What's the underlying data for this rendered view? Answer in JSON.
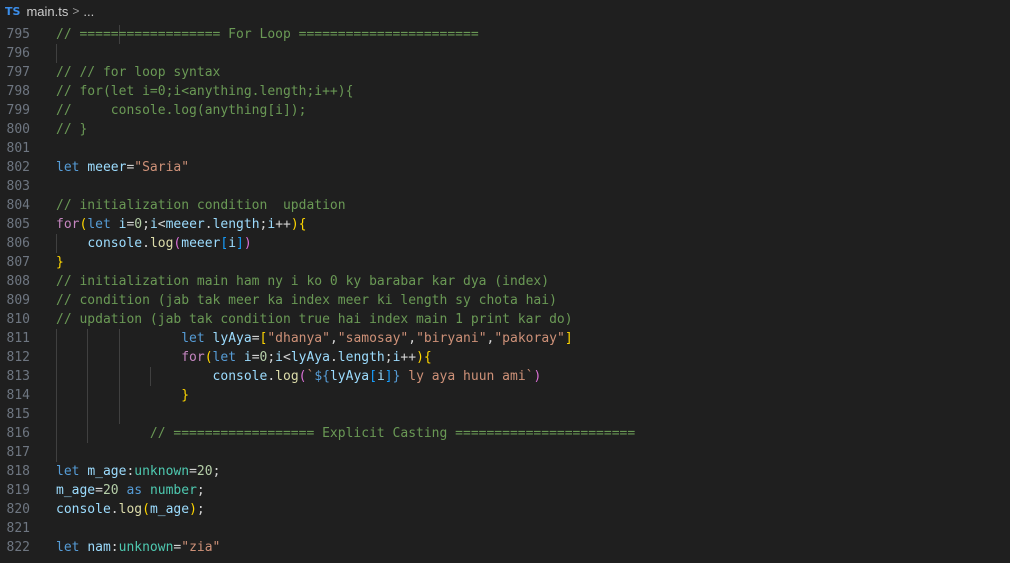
{
  "breadcrumb": {
    "lang_badge": "TS",
    "file": "main.ts",
    "separator": ">",
    "more": "..."
  },
  "editor": {
    "lines": [
      {
        "n": "795",
        "guides": [
          2
        ],
        "tokens": [
          [
            "cm",
            "// ================== For Loop ======================="
          ]
        ]
      },
      {
        "n": "796",
        "guides": [
          0
        ],
        "tokens": []
      },
      {
        "n": "797",
        "guides": [],
        "tokens": [
          [
            "cm",
            "// // for loop syntax"
          ]
        ]
      },
      {
        "n": "798",
        "guides": [],
        "tokens": [
          [
            "cm",
            "// for(let i=0;i<anything.length;i++){"
          ]
        ]
      },
      {
        "n": "799",
        "guides": [],
        "tokens": [
          [
            "cm",
            "//     console.log(anything[i]);"
          ]
        ]
      },
      {
        "n": "800",
        "guides": [],
        "tokens": [
          [
            "cm",
            "// }"
          ]
        ]
      },
      {
        "n": "801",
        "guides": [],
        "tokens": []
      },
      {
        "n": "802",
        "guides": [],
        "tokens": [
          [
            "kw",
            "let "
          ],
          [
            "var",
            "meeer"
          ],
          [
            "pl",
            "="
          ],
          [
            "str",
            "\"Saria\""
          ]
        ]
      },
      {
        "n": "803",
        "guides": [],
        "tokens": []
      },
      {
        "n": "804",
        "guides": [],
        "tokens": [
          [
            "cm",
            "// initialization condition  updation"
          ]
        ]
      },
      {
        "n": "805",
        "guides": [],
        "tokens": [
          [
            "ctl",
            "for"
          ],
          [
            "b1",
            "("
          ],
          [
            "kw",
            "let "
          ],
          [
            "var",
            "i"
          ],
          [
            "pl",
            "="
          ],
          [
            "num",
            "0"
          ],
          [
            "pl",
            ";"
          ],
          [
            "var",
            "i"
          ],
          [
            "pl",
            "<"
          ],
          [
            "var",
            "meeer"
          ],
          [
            "pl",
            "."
          ],
          [
            "var",
            "length"
          ],
          [
            "pl",
            ";"
          ],
          [
            "var",
            "i"
          ],
          [
            "pl",
            "++"
          ],
          [
            "b1",
            ")"
          ],
          [
            "b1",
            "{"
          ]
        ]
      },
      {
        "n": "806",
        "guides": [
          0
        ],
        "tokens": [
          [
            "pl",
            "    "
          ],
          [
            "var",
            "console"
          ],
          [
            "pl",
            "."
          ],
          [
            "fn",
            "log"
          ],
          [
            "b2",
            "("
          ],
          [
            "var",
            "meeer"
          ],
          [
            "b3",
            "["
          ],
          [
            "var",
            "i"
          ],
          [
            "b3",
            "]"
          ],
          [
            "b2",
            ")"
          ]
        ]
      },
      {
        "n": "807",
        "guides": [],
        "tokens": [
          [
            "b1",
            "}"
          ]
        ]
      },
      {
        "n": "808",
        "guides": [],
        "tokens": [
          [
            "cm",
            "// initialization main ham ny i ko 0 ky barabar kar dya (index)"
          ]
        ]
      },
      {
        "n": "809",
        "guides": [],
        "tokens": [
          [
            "cm",
            "// condition (jab tak meer ka index meer ki length sy chota hai)"
          ]
        ]
      },
      {
        "n": "810",
        "guides": [],
        "tokens": [
          [
            "cm",
            "// updation (jab tak condition true hai index main 1 print kar do)"
          ]
        ]
      },
      {
        "n": "811",
        "guides": [
          0,
          1,
          2
        ],
        "tokens": [
          [
            "pl",
            "                "
          ],
          [
            "kw",
            "let "
          ],
          [
            "var",
            "lyAya"
          ],
          [
            "pl",
            "="
          ],
          [
            "b1",
            "["
          ],
          [
            "str",
            "\"dhanya\""
          ],
          [
            "pl",
            ","
          ],
          [
            "str",
            "\"samosay\""
          ],
          [
            "pl",
            ","
          ],
          [
            "str",
            "\"biryani\""
          ],
          [
            "pl",
            ","
          ],
          [
            "str",
            "\"pakoray\""
          ],
          [
            "b1",
            "]"
          ]
        ]
      },
      {
        "n": "812",
        "guides": [
          0,
          1,
          2
        ],
        "tokens": [
          [
            "pl",
            "                "
          ],
          [
            "ctl",
            "for"
          ],
          [
            "b1",
            "("
          ],
          [
            "kw",
            "let "
          ],
          [
            "var",
            "i"
          ],
          [
            "pl",
            "="
          ],
          [
            "num",
            "0"
          ],
          [
            "pl",
            ";"
          ],
          [
            "var",
            "i"
          ],
          [
            "pl",
            "<"
          ],
          [
            "var",
            "lyAya"
          ],
          [
            "pl",
            "."
          ],
          [
            "var",
            "length"
          ],
          [
            "pl",
            ";"
          ],
          [
            "var",
            "i"
          ],
          [
            "pl",
            "++"
          ],
          [
            "b1",
            ")"
          ],
          [
            "b1",
            "{"
          ]
        ]
      },
      {
        "n": "813",
        "guides": [
          0,
          1,
          2,
          3
        ],
        "tokens": [
          [
            "pl",
            "                    "
          ],
          [
            "var",
            "console"
          ],
          [
            "pl",
            "."
          ],
          [
            "fn",
            "log"
          ],
          [
            "b2",
            "("
          ],
          [
            "str",
            "`"
          ],
          [
            "kw",
            "${"
          ],
          [
            "var",
            "lyAya"
          ],
          [
            "b3",
            "["
          ],
          [
            "var",
            "i"
          ],
          [
            "b3",
            "]"
          ],
          [
            "kw",
            "}"
          ],
          [
            "str",
            " ly aya huun ami`"
          ],
          [
            "b2",
            ")"
          ]
        ]
      },
      {
        "n": "814",
        "guides": [
          0,
          1,
          2
        ],
        "tokens": [
          [
            "pl",
            "                "
          ],
          [
            "b1",
            "}"
          ]
        ]
      },
      {
        "n": "815",
        "guides": [
          0,
          1,
          2
        ],
        "tokens": []
      },
      {
        "n": "816",
        "guides": [
          0,
          1
        ],
        "tokens": [
          [
            "pl",
            "            "
          ],
          [
            "cm",
            "// ================== Explicit Casting ======================="
          ]
        ]
      },
      {
        "n": "817",
        "guides": [
          0
        ],
        "tokens": []
      },
      {
        "n": "818",
        "guides": [],
        "tokens": [
          [
            "kw",
            "let "
          ],
          [
            "var",
            "m_age"
          ],
          [
            "pl",
            ":"
          ],
          [
            "ty",
            "unknown"
          ],
          [
            "pl",
            "="
          ],
          [
            "num",
            "20"
          ],
          [
            "pl",
            ";"
          ]
        ]
      },
      {
        "n": "819",
        "guides": [],
        "tokens": [
          [
            "var",
            "m_age"
          ],
          [
            "pl",
            "="
          ],
          [
            "num",
            "20"
          ],
          [
            "pl",
            " "
          ],
          [
            "kw",
            "as"
          ],
          [
            "pl",
            " "
          ],
          [
            "ty",
            "number"
          ],
          [
            "pl",
            ";"
          ]
        ]
      },
      {
        "n": "820",
        "guides": [],
        "tokens": [
          [
            "var",
            "console"
          ],
          [
            "pl",
            "."
          ],
          [
            "fn",
            "log"
          ],
          [
            "b1",
            "("
          ],
          [
            "var",
            "m_age"
          ],
          [
            "b1",
            ")"
          ],
          [
            "pl",
            ";"
          ]
        ]
      },
      {
        "n": "821",
        "guides": [],
        "tokens": []
      },
      {
        "n": "822",
        "guides": [],
        "tokens": [
          [
            "kw",
            "let "
          ],
          [
            "var",
            "nam"
          ],
          [
            "pl",
            ":"
          ],
          [
            "ty",
            "unknown"
          ],
          [
            "pl",
            "="
          ],
          [
            "str",
            "\"zia\""
          ]
        ]
      }
    ]
  }
}
